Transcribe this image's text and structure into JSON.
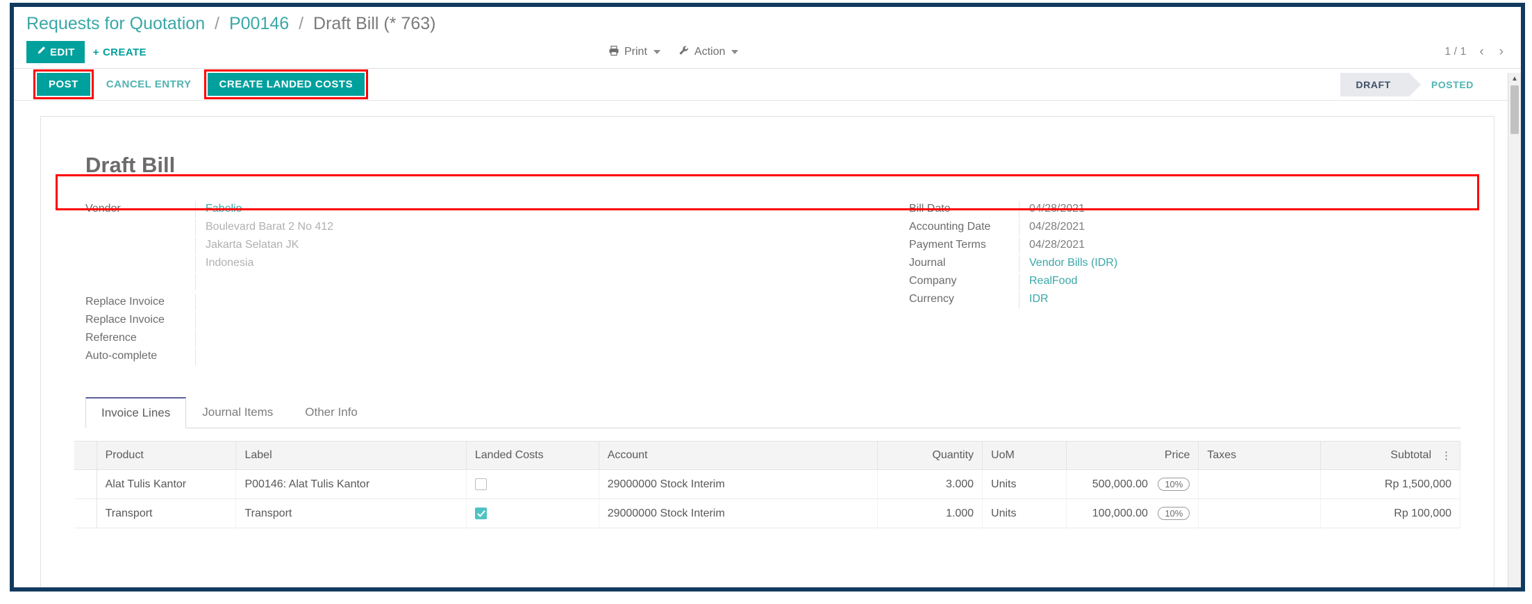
{
  "breadcrumb": {
    "root": "Requests for Quotation",
    "sep": "/",
    "parent": "P00146",
    "current": "Draft Bill (* 763)"
  },
  "control_panel": {
    "edit_label": "EDIT",
    "create_label": "CREATE",
    "print_label": "Print",
    "action_label": "Action",
    "pager_value": "1 / 1",
    "prev_glyph": "‹",
    "next_glyph": "›"
  },
  "status_bar": {
    "post_label": "POST",
    "cancel_entry_label": "CANCEL ENTRY",
    "create_landed_costs_label": "CREATE LANDED COSTS",
    "stages": [
      {
        "label": "DRAFT",
        "state": "active"
      },
      {
        "label": "POSTED",
        "state": "todo"
      }
    ]
  },
  "form": {
    "title": "Draft Bill",
    "left_fields": [
      {
        "label": "Vendor",
        "value": "Fabelio",
        "style": "link"
      },
      {
        "label": "",
        "value": "Boulevard Barat 2 No 412",
        "style": "muted"
      },
      {
        "label": "",
        "value": "Jakarta Selatan JK",
        "style": "muted"
      },
      {
        "label": "",
        "value": "Indonesia",
        "style": "muted"
      },
      {
        "label": "Replace Invoice",
        "value": "",
        "style": "plain"
      },
      {
        "label": "Replace Invoice",
        "value": "",
        "style": "plain"
      },
      {
        "label": "Reference",
        "value": "",
        "style": "plain"
      },
      {
        "label": "Auto-complete",
        "value": "",
        "style": "plain"
      }
    ],
    "right_fields": [
      {
        "label": "Bill Date",
        "value": "04/28/2021",
        "style": "plain"
      },
      {
        "label": "Accounting Date",
        "value": "04/28/2021",
        "style": "plain"
      },
      {
        "label": "Payment Terms",
        "value": "04/28/2021",
        "style": "plain"
      },
      {
        "label": "Journal",
        "value": "Vendor Bills (IDR)",
        "style": "link"
      },
      {
        "label": "Company",
        "value": "RealFood",
        "style": "link"
      },
      {
        "label": "Currency",
        "value": "IDR",
        "style": "link"
      }
    ]
  },
  "notebook": {
    "tabs": [
      {
        "label": "Invoice Lines",
        "active": true
      },
      {
        "label": "Journal Items",
        "active": false
      },
      {
        "label": "Other Info",
        "active": false
      }
    ]
  },
  "lines_table": {
    "columns": [
      {
        "label": "Product",
        "align": "left"
      },
      {
        "label": "Label",
        "align": "left"
      },
      {
        "label": "Landed Costs",
        "align": "left"
      },
      {
        "label": "Account",
        "align": "left"
      },
      {
        "label": "Quantity",
        "align": "right"
      },
      {
        "label": "UoM",
        "align": "left"
      },
      {
        "label": "Price",
        "align": "right"
      },
      {
        "label": "Taxes",
        "align": "left"
      },
      {
        "label": "Subtotal",
        "align": "right"
      }
    ],
    "optional_columns_glyph": "⋮",
    "rows": [
      {
        "product": "Alat Tulis Kantor",
        "label": "P00146: Alat Tulis Kantor",
        "landed_costs_checked": false,
        "account": "29000000 Stock Interim",
        "quantity": "3.000",
        "uom": "Units",
        "price": "500,000.00",
        "tax": "10%",
        "subtotal": "Rp 1,500,000",
        "highlighted": false
      },
      {
        "product": "Transport",
        "label": "Transport",
        "landed_costs_checked": true,
        "account": "29000000 Stock Interim",
        "quantity": "1.000",
        "uom": "Units",
        "price": "100,000.00",
        "tax": "10%",
        "subtotal": "Rp 100,000",
        "highlighted": true
      }
    ]
  },
  "colors": {
    "frame": "#123a5e",
    "accent_teal": "#00a09d",
    "link_teal": "#3aa7a7",
    "annotation_red": "#ff0000",
    "stage_active_bg": "#e7e9ed"
  }
}
